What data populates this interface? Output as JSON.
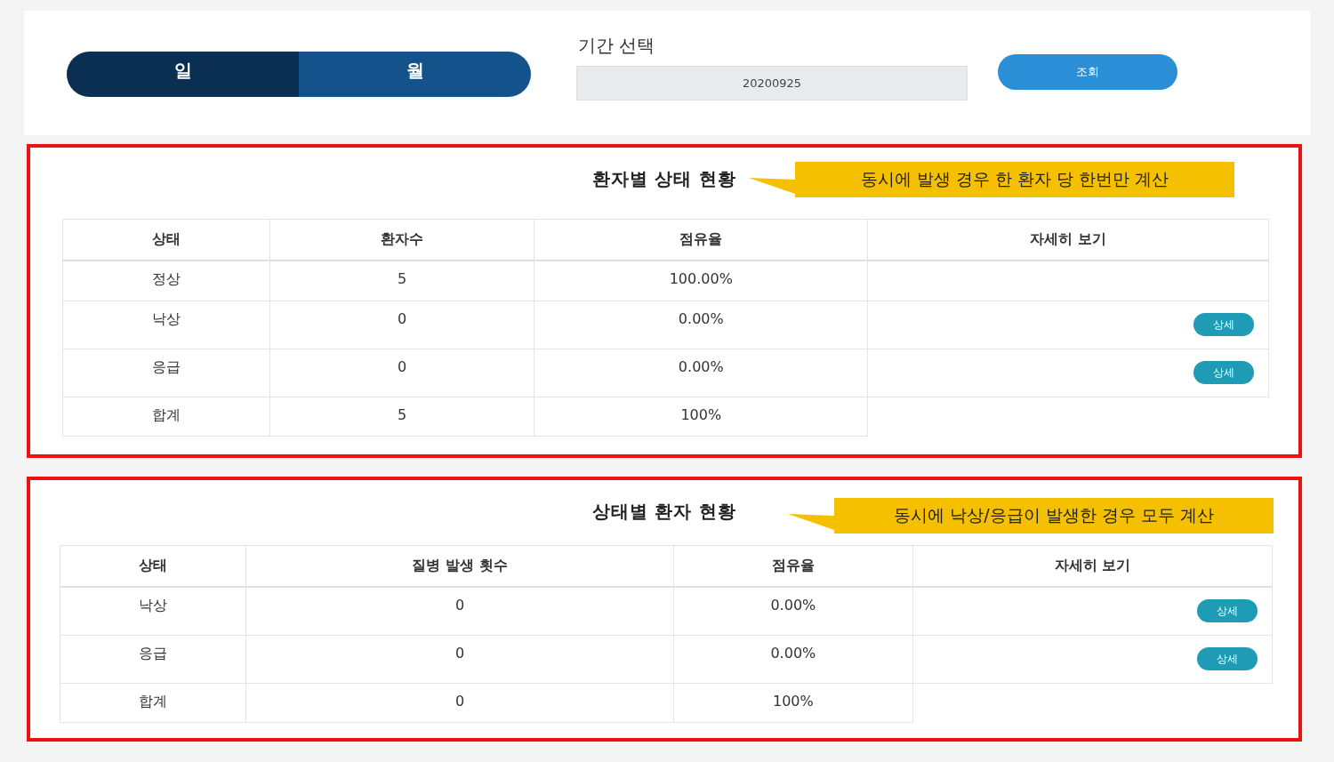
{
  "period_toggle": [
    {
      "label": "일",
      "selected": true
    },
    {
      "label": "월",
      "selected": false
    }
  ],
  "period": {
    "label": "기간 선택",
    "value": "20200925"
  },
  "search_button": "조회",
  "sections": [
    {
      "title": "환자별 상태 현황",
      "note": "동시에 발생 경우 한 환자 당 한번만 계산",
      "columns": [
        "상태",
        "환자수",
        "점유율",
        "자세히 보기"
      ],
      "rows": [
        {
          "kind": "data",
          "cells": [
            "정상",
            "5",
            "100.00%"
          ]
        },
        {
          "kind": "data",
          "cells": [
            "낙상",
            "0",
            "0.00%"
          ],
          "detail_button": "상세"
        },
        {
          "kind": "data",
          "cells": [
            "응급",
            "0",
            "0.00%"
          ],
          "detail_button": "상세"
        },
        {
          "kind": "total",
          "cells": [
            "합계",
            "5",
            "100%"
          ]
        }
      ]
    },
    {
      "title": "상태별 환자 현황",
      "note": "동시에 낙상/응급이 발생한 경우 모두 계산",
      "columns": [
        "상태",
        "질병 발생 횟수",
        "점유율",
        "자세히 보기"
      ],
      "rows": [
        {
          "kind": "data",
          "cells": [
            "낙상",
            "0",
            "0.00%"
          ],
          "detail_button": "상세"
        },
        {
          "kind": "data",
          "cells": [
            "응급",
            "0",
            "0.00%"
          ],
          "detail_button": "상세"
        },
        {
          "kind": "total",
          "cells": [
            "합계",
            "0",
            "100%"
          ]
        }
      ]
    }
  ]
}
